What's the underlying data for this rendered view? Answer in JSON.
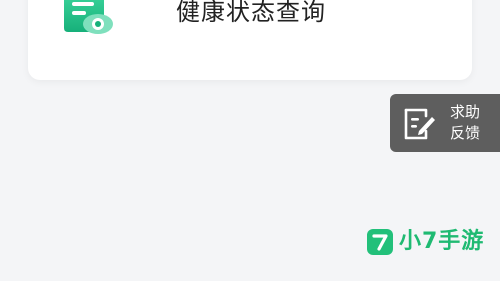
{
  "card": {
    "title": "健康状态查询",
    "icon": "health-document-eye-icon"
  },
  "feedback": {
    "line1": "求助",
    "line2": "反馈",
    "icon": "edit-note-icon"
  },
  "watermark": {
    "badge_text": "7",
    "text": "小7手游",
    "color": "#1fba72"
  },
  "colors": {
    "accent": "#22c07a",
    "background": "#f4f5f7",
    "feedback_bg": "#5e5e5e"
  }
}
